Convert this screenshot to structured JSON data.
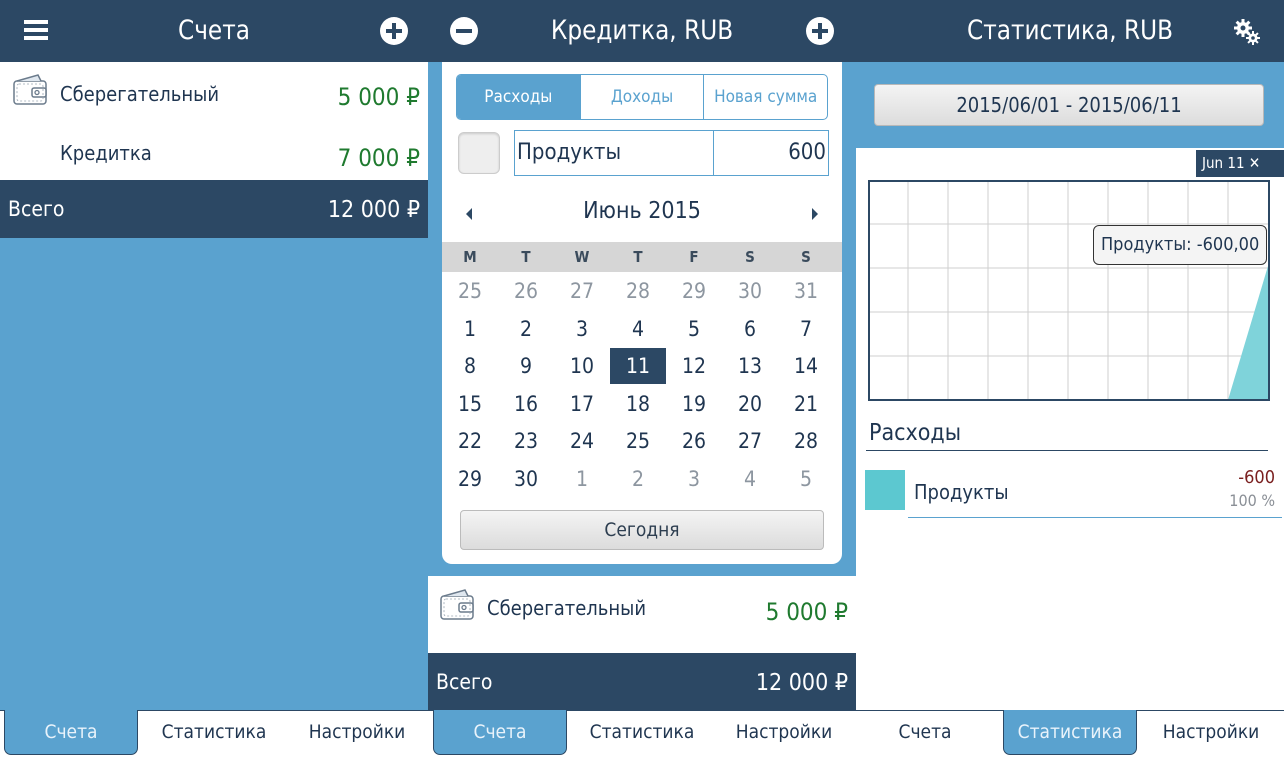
{
  "panel1": {
    "header": {
      "title": "Счета",
      "menu_icon": "hamburger-icon",
      "add_icon": "plus-circle-icon"
    },
    "accounts": [
      {
        "name": "Сберегательный",
        "amount": "5 000 ₽",
        "icon": "wallet-icon"
      },
      {
        "name": "Кредитка",
        "amount": "7 000 ₽"
      }
    ],
    "total": {
      "label": "Всего",
      "amount": "12 000 ₽"
    },
    "tabs": [
      "Счета",
      "Статистика",
      "Настройки"
    ],
    "active_tab": 0
  },
  "panel2": {
    "header": {
      "title": "Кредитка, RUB",
      "remove_icon": "minus-circle-icon",
      "add_icon": "plus-circle-icon"
    },
    "segments": [
      "Расходы",
      "Доходы",
      "Новая сумма"
    ],
    "active_segment": 0,
    "category_value": "Продукты",
    "amount_value": "600",
    "calendar": {
      "month": "Июнь 2015",
      "weekdays": [
        "M",
        "T",
        "W",
        "T",
        "F",
        "S",
        "S"
      ],
      "weeks": [
        [
          "25",
          "26",
          "27",
          "28",
          "29",
          "30",
          "31"
        ],
        [
          "1",
          "2",
          "3",
          "4",
          "5",
          "6",
          "7"
        ],
        [
          "8",
          "9",
          "10",
          "11",
          "12",
          "13",
          "14"
        ],
        [
          "15",
          "16",
          "17",
          "18",
          "19",
          "20",
          "21"
        ],
        [
          "22",
          "23",
          "24",
          "25",
          "26",
          "27",
          "28"
        ],
        [
          "29",
          "30",
          "1",
          "2",
          "3",
          "4",
          "5"
        ]
      ],
      "selected_day": "11",
      "today_label": "Сегодня"
    },
    "accounts": [
      {
        "name": "Сберегательный",
        "amount": "5 000 ₽",
        "icon": "wallet-icon"
      }
    ],
    "total": {
      "label": "Всего",
      "amount": "12 000 ₽"
    },
    "tabs": [
      "Счета",
      "Статистика",
      "Настройки"
    ],
    "active_tab": 0
  },
  "panel3": {
    "header": {
      "title": "Статистика, RUB",
      "settings_icon": "gears-icon"
    },
    "date_range": "2015/06/01 - 2015/06/11",
    "chart_tag": "Jun 11 ✕",
    "tooltip": "Продукты: -600,00",
    "section_title": "Расходы",
    "legend": {
      "name": "Продукты",
      "value": "-600",
      "percent": "100 %",
      "color": "#5cc8d0"
    },
    "tabs": [
      "Счета",
      "Статистика",
      "Настройки"
    ],
    "active_tab": 1
  },
  "colors": {
    "header": "#2c4864",
    "accent": "#5aa2cf",
    "positive": "#1f7a2f",
    "negative": "#7a1f1f",
    "series": "#5cc8d0"
  }
}
